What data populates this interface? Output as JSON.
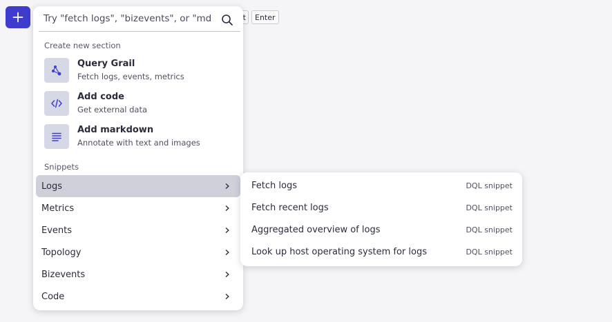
{
  "toolbar": {
    "add_button_icon": "plus-icon",
    "kbd_shift": "ft",
    "kbd_enter": "Enter"
  },
  "menu": {
    "search": {
      "placeholder": "Try \"fetch logs\", \"bizevents\", or \"md\"",
      "value": "",
      "icon": "search-icon"
    },
    "create_heading": "Create new section",
    "create_items": [
      {
        "title": "Query Grail",
        "subtitle": "Fetch logs, events, metrics",
        "icon": "grail-icon"
      },
      {
        "title": "Add code",
        "subtitle": "Get external data",
        "icon": "code-icon"
      },
      {
        "title": "Add markdown",
        "subtitle": "Annotate with text and images",
        "icon": "markdown-icon"
      }
    ],
    "snippets_heading": "Snippets",
    "snippets": [
      {
        "label": "Logs",
        "active": true
      },
      {
        "label": "Metrics"
      },
      {
        "label": "Events"
      },
      {
        "label": "Topology"
      },
      {
        "label": "Bizevents"
      },
      {
        "label": "Code"
      }
    ]
  },
  "submenu": {
    "items": [
      {
        "label": "Fetch logs",
        "tag": "DQL snippet"
      },
      {
        "label": "Fetch recent logs",
        "tag": "DQL snippet"
      },
      {
        "label": "Aggregated overview of logs",
        "tag": "DQL snippet"
      },
      {
        "label": "Look up host operating system for logs",
        "tag": "DQL snippet"
      }
    ]
  },
  "colors": {
    "accent": "#3e3ccf",
    "tile_bg": "#d7d8e5",
    "active_row": "#cfd0da",
    "background": "#f5f5f7"
  }
}
